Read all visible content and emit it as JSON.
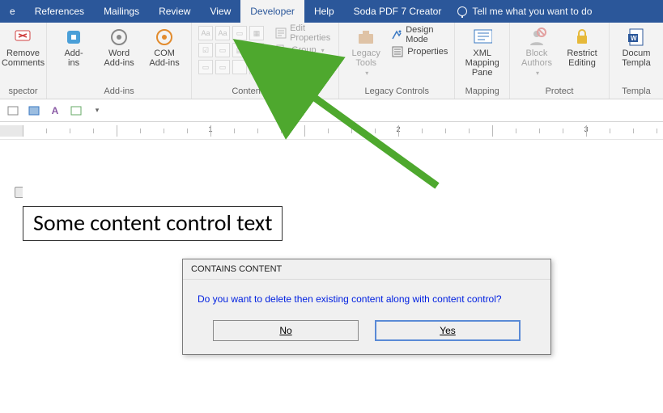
{
  "tabs": [
    "e",
    "References",
    "Mailings",
    "Review",
    "View",
    "Developer",
    "Help",
    "Soda PDF 7 Creator"
  ],
  "active_tab_index": 5,
  "tellme": "Tell me what you want to do",
  "ribbon": {
    "remove_comments": "Remove\nComments",
    "spector": "spector",
    "addins": "Add-\nins",
    "word_addins": "Word\nAdd-ins",
    "com_addins": "COM\nAdd-ins",
    "addins_group": "Add-ins",
    "edit_properties": "Edit Properties",
    "group": "Group",
    "delete": "Delete",
    "content_controls_group": "Content Controls",
    "legacy_tools": "Legacy\nTools",
    "design_mode": "Design Mode",
    "properties": "Properties",
    "legacy_group": "Legacy Controls",
    "xml_mapping": "XML Mapping\nPane",
    "mapping_group": "Mapping",
    "block_authors": "Block\nAuthors",
    "restrict_editing": "Restrict\nEditing",
    "protect_group": "Protect",
    "doc_template": "Docum\nTempla",
    "template_group": "Templa"
  },
  "ruler_numbers": [
    "1",
    "2",
    "3"
  ],
  "content_text": "Some content control text",
  "dialog": {
    "title": "CONTAINS CONTENT",
    "message": "Do you want to delete then existing content along with content control?",
    "no": "No",
    "yes": "Yes"
  }
}
